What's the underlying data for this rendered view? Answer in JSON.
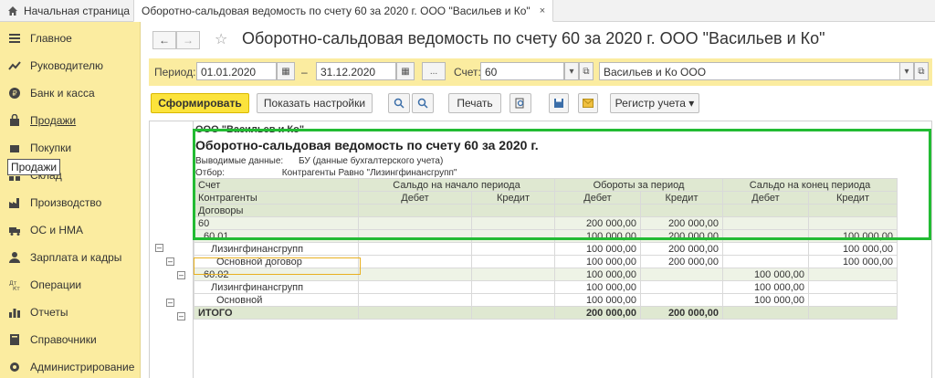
{
  "tabs": {
    "home": "Начальная страница",
    "active": "Оборотно-сальдовая ведомость по счету 60 за 2020 г. ООО \"Васильев и Ко\"",
    "close": "×"
  },
  "sidebar": {
    "items": [
      {
        "label": "Главное",
        "icon": "menu-icon"
      },
      {
        "label": "Руководителю",
        "icon": "chart-icon"
      },
      {
        "label": "Банк и касса",
        "icon": "bank-icon"
      },
      {
        "label": "Продажи",
        "icon": "sales-icon"
      },
      {
        "label": "Покупки",
        "icon": "purchases-icon"
      },
      {
        "label": "Склад",
        "icon": "warehouse-icon"
      },
      {
        "label": "Производство",
        "icon": "production-icon"
      },
      {
        "label": "ОС и НМА",
        "icon": "truck-icon"
      },
      {
        "label": "Зарплата и кадры",
        "icon": "people-icon"
      },
      {
        "label": "Операции",
        "icon": "operations-icon"
      },
      {
        "label": "Отчеты",
        "icon": "reports-icon"
      },
      {
        "label": "Справочники",
        "icon": "catalog-icon"
      },
      {
        "label": "Администрирование",
        "icon": "settings-icon"
      }
    ],
    "tooltip": "Продажи"
  },
  "header": {
    "back": "←",
    "forward": "→",
    "star": "☆",
    "title": "Оборотно-сальдовая ведомость по счету 60 за 2020 г. ООО \"Васильев и Ко\""
  },
  "params": {
    "period_label": "Период:",
    "date_from": "01.01.2020",
    "dash": "–",
    "date_to": "31.12.2020",
    "dots": "...",
    "account_label": "Счет:",
    "account": "60",
    "org": "Васильев и Ко ООО"
  },
  "toolbar": {
    "generate": "Сформировать",
    "show_settings": "Показать настройки",
    "print": "Печать",
    "register": "Регистр учета ▾"
  },
  "report": {
    "org": "ООО \"Васильев и Ко\"",
    "title": "Оборотно-сальдовая ведомость по счету 60 за 2020 г.",
    "output_label": "Выводимые данные:",
    "output_value": "БУ (данные бухгалтерского учета)",
    "filter_label": "Отбор:",
    "filter_value": "Контрагенты Равно \"Лизингфинансгрупп\"",
    "col_account": "Счет",
    "col_contractors": "Контрагенты",
    "col_contracts": "Договоры",
    "col_open": "Сальдо на начало периода",
    "col_turnover": "Обороты за период",
    "col_close": "Сальдо на конец периода",
    "debit": "Дебет",
    "credit": "Кредит",
    "rows": [
      {
        "name": "60",
        "indent": 0,
        "od": "",
        "oc": "",
        "td": "200 000,00",
        "tc": "200 000,00",
        "cd": "",
        "cc": ""
      },
      {
        "name": "60.01",
        "indent": 1,
        "od": "",
        "oc": "",
        "td": "100 000,00",
        "tc": "200 000,00",
        "cd": "",
        "cc": "100 000,00"
      },
      {
        "name": "Лизингфинансгрупп",
        "indent": 2,
        "od": "",
        "oc": "",
        "td": "100 000,00",
        "tc": "200 000,00",
        "cd": "",
        "cc": "100 000,00"
      },
      {
        "name": "Основной договор",
        "indent": 3,
        "od": "",
        "oc": "",
        "td": "100 000,00",
        "tc": "200 000,00",
        "cd": "",
        "cc": "100 000,00"
      },
      {
        "name": "60.02",
        "indent": 1,
        "od": "",
        "oc": "",
        "td": "100 000,00",
        "tc": "",
        "cd": "100 000,00",
        "cc": ""
      },
      {
        "name": "Лизингфинансгрупп",
        "indent": 2,
        "od": "",
        "oc": "",
        "td": "100 000,00",
        "tc": "",
        "cd": "100 000,00",
        "cc": ""
      },
      {
        "name": "Основной",
        "indent": 3,
        "od": "",
        "oc": "",
        "td": "100 000,00",
        "tc": "",
        "cd": "100 000,00",
        "cc": ""
      }
    ],
    "total": {
      "name": "Итого",
      "td": "200 000,00",
      "tc": "200 000,00"
    }
  },
  "colors": {
    "sidebar": "#fbeca0",
    "primary": "#fce33c",
    "highlight": "#22bb33",
    "header_row": "#dfe8d1"
  }
}
